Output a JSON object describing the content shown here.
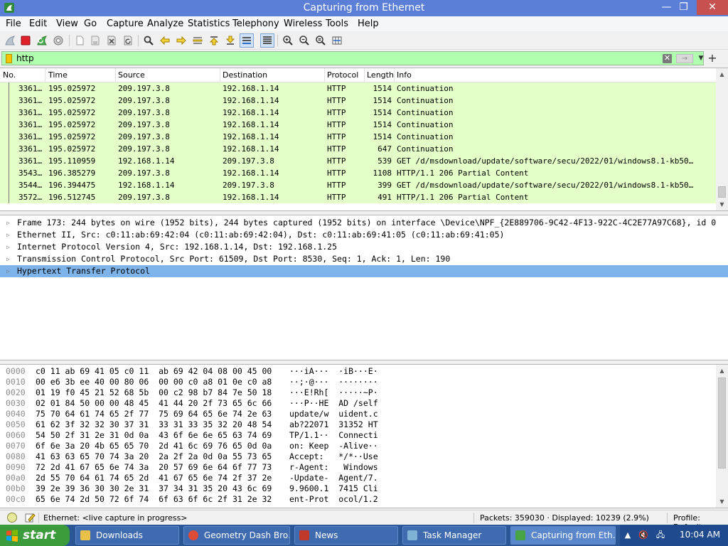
{
  "window": {
    "title": "Capturing from Ethernet",
    "min_glyph": "—",
    "max_glyph": "❐",
    "close_glyph": "✕"
  },
  "menu": [
    "File",
    "Edit",
    "View",
    "Go",
    "Capture",
    "Analyze",
    "Statistics",
    "Telephony",
    "Wireless",
    "Tools",
    "Help"
  ],
  "toolbar": {
    "icons": [
      "shark-fin-start-icon",
      "stop-capture-icon",
      "restart-capture-icon",
      "capture-options-icon",
      "open-file-icon",
      "save-file-icon",
      "close-file-icon",
      "reload-file-icon",
      "find-packet-icon",
      "go-back-icon",
      "go-forward-icon",
      "go-to-packet-icon",
      "go-first-icon",
      "go-last-icon",
      "auto-scroll-icon",
      "colorize-icon",
      "zoom-in-icon",
      "zoom-out-icon",
      "zoom-normal-icon",
      "resize-columns-icon"
    ]
  },
  "filter": {
    "value": "http",
    "clear_glyph": "✕",
    "apply_glyph": "→",
    "dropdown_glyph": "▼",
    "add_glyph": "+"
  },
  "packet_list": {
    "columns": [
      "No.",
      "Time",
      "Source",
      "Destination",
      "Protocol",
      "Length",
      "Info"
    ],
    "rows": [
      [
        "3361…",
        "195.025972",
        "209.197.3.8",
        "192.168.1.14",
        "HTTP",
        "1514",
        "Continuation"
      ],
      [
        "3361…",
        "195.025972",
        "209.197.3.8",
        "192.168.1.14",
        "HTTP",
        "1514",
        "Continuation"
      ],
      [
        "3361…",
        "195.025972",
        "209.197.3.8",
        "192.168.1.14",
        "HTTP",
        "1514",
        "Continuation"
      ],
      [
        "3361…",
        "195.025972",
        "209.197.3.8",
        "192.168.1.14",
        "HTTP",
        "1514",
        "Continuation"
      ],
      [
        "3361…",
        "195.025972",
        "209.197.3.8",
        "192.168.1.14",
        "HTTP",
        "1514",
        "Continuation"
      ],
      [
        "3361…",
        "195.025972",
        "209.197.3.8",
        "192.168.1.14",
        "HTTP",
        "647",
        "Continuation"
      ],
      [
        "3361…",
        "195.110959",
        "192.168.1.14",
        "209.197.3.8",
        "HTTP",
        "539",
        "GET /d/msdownload/update/software/secu/2022/01/windows8.1-kb50…"
      ],
      [
        "3543…",
        "196.385279",
        "209.197.3.8",
        "192.168.1.14",
        "HTTP",
        "1108",
        "HTTP/1.1 206 Partial Content"
      ],
      [
        "3544…",
        "196.394475",
        "192.168.1.14",
        "209.197.3.8",
        "HTTP",
        "399",
        "GET /d/msdownload/update/software/secu/2022/01/windows8.1-kb50…"
      ],
      [
        "3572…",
        "196.512745",
        "209.197.3.8",
        "192.168.1.14",
        "HTTP",
        "491",
        "HTTP/1.1 206 Partial Content"
      ]
    ],
    "row_color": "#e4ffc7"
  },
  "details": {
    "rows": [
      "Frame 173: 244 bytes on wire (1952 bits), 244 bytes captured (1952 bits) on interface \\Device\\NPF_{2E889706-9C42-4F13-922C-4C2E77A97C68}, id 0",
      "Ethernet II, Src: c0:11:ab:69:42:04 (c0:11:ab:69:42:04), Dst: c0:11:ab:69:41:05 (c0:11:ab:69:41:05)",
      "Internet Protocol Version 4, Src: 192.168.1.14, Dst: 192.168.1.25",
      "Transmission Control Protocol, Src Port: 61509, Dst Port: 8530, Seq: 1, Ack: 1, Len: 190",
      "Hypertext Transfer Protocol"
    ],
    "selected_index": 4,
    "expander_glyph": "▷"
  },
  "bytes": {
    "rows": [
      {
        "off": "0000",
        "hex": "c0 11 ab 69 41 05 c0 11  ab 69 42 04 08 00 45 00",
        "ascii": "···iA···  ·iB···E·"
      },
      {
        "off": "0010",
        "hex": "00 e6 3b ee 40 00 80 06  00 00 c0 a8 01 0e c0 a8",
        "ascii": "··;·@···  ········"
      },
      {
        "off": "0020",
        "hex": "01 19 f0 45 21 52 68 5b  00 c2 98 b7 84 7e 50 18",
        "ascii": "···E!Rh[  ·····~P·"
      },
      {
        "off": "0030",
        "hex": "02 01 84 50 00 00 48 45  41 44 20 2f 73 65 6c 66",
        "ascii": "···P··HE  AD /self"
      },
      {
        "off": "0040",
        "hex": "75 70 64 61 74 65 2f 77  75 69 64 65 6e 74 2e 63",
        "ascii": "update/w  uident.c"
      },
      {
        "off": "0050",
        "hex": "61 62 3f 32 32 30 37 31  33 31 33 35 32 20 48 54",
        "ascii": "ab?22071  31352 HT"
      },
      {
        "off": "0060",
        "hex": "54 50 2f 31 2e 31 0d 0a  43 6f 6e 6e 65 63 74 69",
        "ascii": "TP/1.1··  Connecti"
      },
      {
        "off": "0070",
        "hex": "6f 6e 3a 20 4b 65 65 70  2d 41 6c 69 76 65 0d 0a",
        "ascii": "on: Keep  -Alive··"
      },
      {
        "off": "0080",
        "hex": "41 63 63 65 70 74 3a 20  2a 2f 2a 0d 0a 55 73 65",
        "ascii": "Accept:   */*··Use"
      },
      {
        "off": "0090",
        "hex": "72 2d 41 67 65 6e 74 3a  20 57 69 6e 64 6f 77 73",
        "ascii": "r-Agent:   Windows"
      },
      {
        "off": "00a0",
        "hex": "2d 55 70 64 61 74 65 2d  41 67 65 6e 74 2f 37 2e",
        "ascii": "-Update-  Agent/7."
      },
      {
        "off": "00b0",
        "hex": "39 2e 39 36 30 30 2e 31  37 34 31 35 20 43 6c 69",
        "ascii": "9.9600.1  7415 Cli"
      },
      {
        "off": "00c0",
        "hex": "65 6e 74 2d 50 72 6f 74  6f 63 6f 6c 2f 31 2e 32",
        "ascii": "ent-Prot  ocol/1.2"
      }
    ]
  },
  "status": {
    "text": "Ethernet: <live capture in progress>",
    "packets": "Packets: 359030 · Displayed: 10239 (2.9%)",
    "profile": "Profile: Default"
  },
  "taskbar": {
    "start_label": "start",
    "tasks": [
      {
        "label": "Downloads",
        "color": "#e8c04a"
      },
      {
        "label": "Geometry Dash Bro…",
        "color": "#de4b39"
      },
      {
        "label": "News",
        "color": "#c0392b"
      },
      {
        "label": "Task Manager",
        "color": "#7fb3d5"
      },
      {
        "label": "Capturing from Eth…",
        "color": "#46a346"
      }
    ],
    "clock": "10:04 AM",
    "tray_glyphs": [
      "▲",
      "🔇",
      "🖧"
    ]
  }
}
